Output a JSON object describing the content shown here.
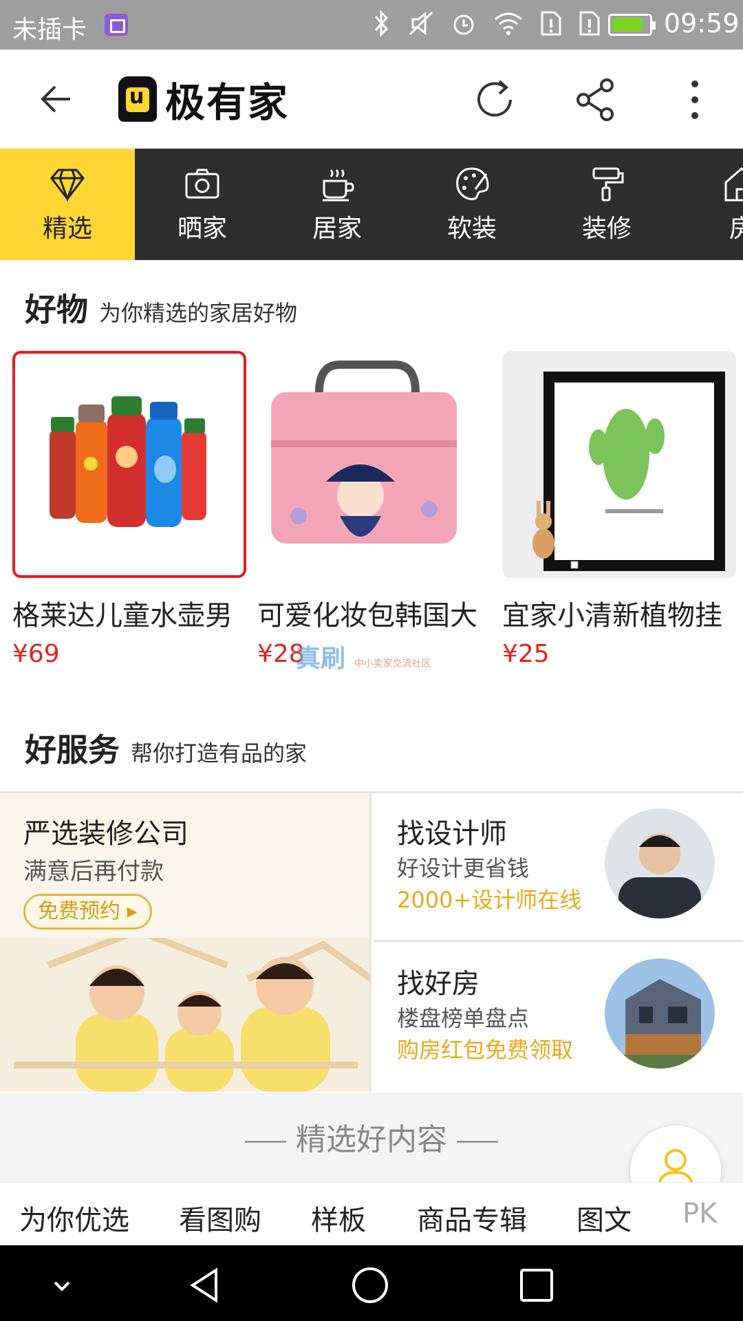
{
  "status_bar": {
    "carrier": "未插卡",
    "time": "09:59",
    "battery_level_pct": 85
  },
  "app_header": {
    "logo_text": "极有家",
    "icons": [
      "back-arrow-icon",
      "refresh-icon",
      "share-icon",
      "more-vert-icon"
    ]
  },
  "categories": [
    {
      "label": "精选",
      "icon": "diamond-icon",
      "active": true
    },
    {
      "label": "晒家",
      "icon": "camera-icon"
    },
    {
      "label": "居家",
      "icon": "cup-icon"
    },
    {
      "label": "软装",
      "icon": "palette-icon"
    },
    {
      "label": "装修",
      "icon": "paint-roller-icon"
    },
    {
      "label": "房",
      "icon": "house-icon"
    }
  ],
  "goods_section": {
    "title_highlight": "好",
    "title_rest": "物",
    "subtitle": "为你精选的家居好物",
    "items": [
      {
        "name": "格莱达儿童水壶男",
        "price": "¥69"
      },
      {
        "name": "可爱化妆包韩国大",
        "price": "¥28"
      },
      {
        "name": "宜家小清新植物挂",
        "price": "¥25"
      }
    ]
  },
  "watermark": {
    "main": "真刷",
    "sub": "中小卖家交流社区"
  },
  "service_section": {
    "title_highlight": "好",
    "title_rest": "服务",
    "subtitle": "帮你打造有品的家",
    "left_card": {
      "title": "严选装修公司",
      "desc": "满意后再付款",
      "badge": "免费预约 ▸"
    },
    "right_cards": [
      {
        "title": "找设计师",
        "desc": "好设计更省钱",
        "highlight": "2000+设计师在线"
      },
      {
        "title": "找好房",
        "desc": "楼盘榜单盘点",
        "highlight": "购房红包免费领取"
      }
    ]
  },
  "content_divider": "精选好内容",
  "bottom_tabs": [
    "为你优选",
    "看图购",
    "样板",
    "商品专辑",
    "图文",
    "PK"
  ],
  "nav_bar": {
    "icons": [
      "chevron-down-icon",
      "back-triangle-icon",
      "home-circle-icon",
      "recents-square-icon"
    ]
  },
  "colors": {
    "accent": "#ffd633",
    "price": "#e0241b",
    "highlight": "#e7a91b",
    "dark_bar": "#2e2e2e"
  }
}
